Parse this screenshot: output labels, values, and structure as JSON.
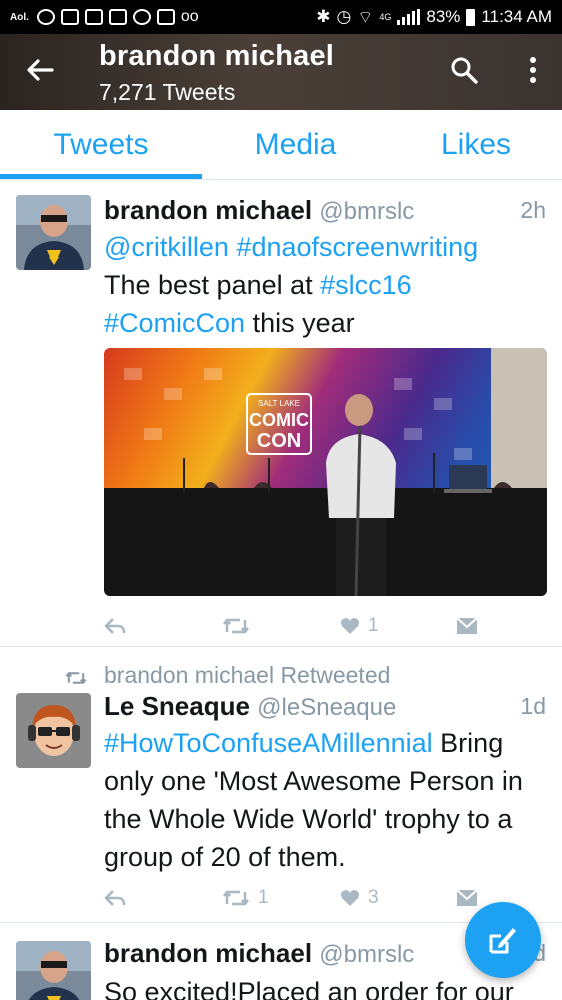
{
  "status_bar": {
    "carrier": "Aol.",
    "network": "4G",
    "battery": "83%",
    "time": "11:34 AM"
  },
  "header": {
    "name": "brandon michael",
    "tweet_count": "7,271 Tweets"
  },
  "tabs": [
    {
      "label": "Tweets",
      "active": true
    },
    {
      "label": "Media",
      "active": false
    },
    {
      "label": "Likes",
      "active": false
    }
  ],
  "tweets": [
    {
      "name": "brandon michael",
      "handle": "@bmrslc",
      "time": "2h",
      "text": {
        "mention": "@critkillen",
        "hashtag1": "#dnaofscreenwriting",
        "plain1": "The best panel at ",
        "hashtag2": "#slcc16",
        "hashtag3": "#ComicCon",
        "plain2": " this year"
      },
      "media": {
        "sign_line1": "SALT LAKE",
        "sign_line2": "COMIC",
        "sign_line3": "CON"
      },
      "likes": "1"
    },
    {
      "retweeted_by": "brandon michael Retweeted",
      "name": "Le Sneaque",
      "handle": "@leSneaque",
      "time": "1d",
      "text": {
        "hashtag": "#HowToConfuseAMillennial",
        "plain": " Bring only one 'Most Awesome Person in the Whole Wide World' trophy to a group of 20 of them."
      },
      "retweets": "1",
      "likes": "3"
    },
    {
      "name": "brandon michael",
      "handle": "@bmrslc",
      "time": "1d",
      "text": "So excited!Placed an order for our"
    }
  ],
  "colors": {
    "accent": "#1da1f2",
    "muted": "#8899a6",
    "icon": "#aab8c2"
  },
  "icons": [
    "back-arrow-icon",
    "search-icon",
    "more-icon",
    "reply-icon",
    "retweet-icon",
    "heart-icon",
    "dm-icon",
    "compose-icon"
  ]
}
